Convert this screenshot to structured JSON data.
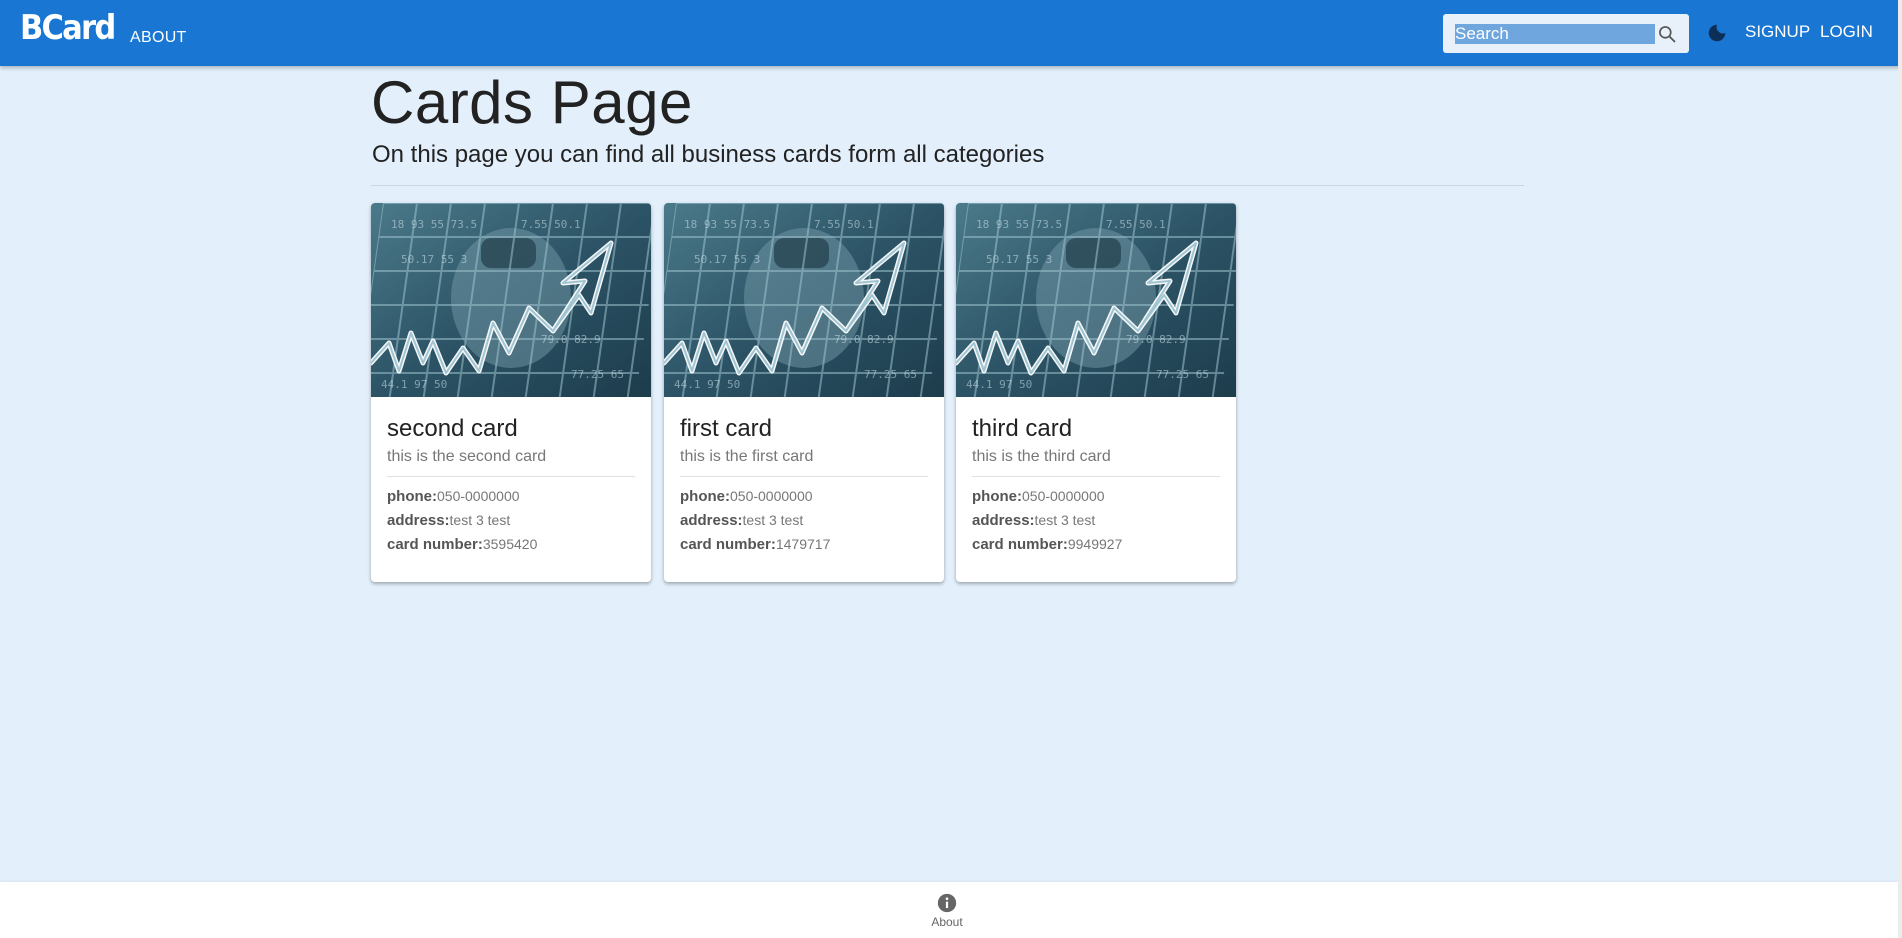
{
  "header": {
    "brand": "BCard",
    "nav_about": "ABOUT",
    "search_placeholder": "Search",
    "search_icon": "search-icon",
    "theme_icon": "moon-icon",
    "signup": "SIGNUP",
    "login": "LOGIN"
  },
  "page": {
    "title": "Cards Page",
    "subtitle": "On this page you can find all business cards form all categories"
  },
  "cards": [
    {
      "title": "second card",
      "subtitle": "this is the second card",
      "phone_label": "phone:",
      "phone": "050-0000000",
      "address_label": "address:",
      "address": "test 3 test",
      "number_label": "card number:",
      "number": "3595420"
    },
    {
      "title": "first card",
      "subtitle": "this is the first card",
      "phone_label": "phone:",
      "phone": "050-0000000",
      "address_label": "address:",
      "address": "test 3 test",
      "number_label": "card number:",
      "number": "1479717"
    },
    {
      "title": "third card",
      "subtitle": "this is the third card",
      "phone_label": "phone:",
      "phone": "050-0000000",
      "address_label": "address:",
      "address": "test 3 test",
      "number_label": "card number:",
      "number": "9949927"
    }
  ],
  "footer": {
    "about_label": "About",
    "about_icon": "info-icon"
  },
  "colors": {
    "appbar": "#1976d2",
    "background": "#e3f0fb",
    "card_image_tint": "#2f5b6b"
  }
}
